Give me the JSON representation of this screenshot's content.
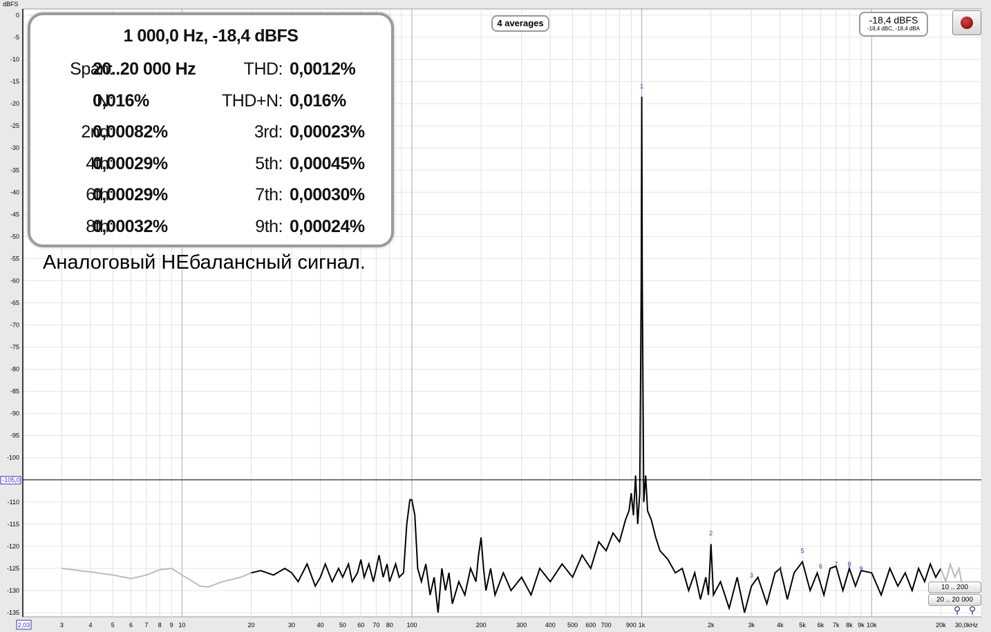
{
  "chart_data": {
    "type": "line",
    "ylabel": "dBFS",
    "xunit": "kHz",
    "x_scale": "log",
    "xlim": [
      2.03,
      30000
    ],
    "ylim": [
      -135,
      0
    ],
    "grid": true,
    "yticks": [
      0,
      -5,
      -10,
      -15,
      -20,
      -25,
      -30,
      -35,
      -40,
      -45,
      -50,
      -55,
      -60,
      -65,
      -70,
      -75,
      -80,
      -85,
      -90,
      -95,
      -100,
      -110,
      -115,
      -120,
      -125,
      -130,
      -135
    ],
    "xtick_labels": [
      [
        "3",
        3
      ],
      [
        "4",
        4
      ],
      [
        "5",
        5
      ],
      [
        "6",
        6
      ],
      [
        "7",
        7
      ],
      [
        "8",
        8
      ],
      [
        "9",
        9
      ],
      [
        "10",
        10
      ],
      [
        "20",
        20
      ],
      [
        "30",
        30
      ],
      [
        "40",
        40
      ],
      [
        "50",
        50
      ],
      [
        "60",
        60
      ],
      [
        "70",
        70
      ],
      [
        "80",
        80
      ],
      [
        "100",
        100
      ],
      [
        "200",
        200
      ],
      [
        "300",
        300
      ],
      [
        "400",
        400
      ],
      [
        "500",
        500
      ],
      [
        "600",
        600
      ],
      [
        "700",
        700
      ],
      [
        "900",
        900
      ],
      [
        "1k",
        1000
      ],
      [
        "2k",
        2000
      ],
      [
        "3k",
        3000
      ],
      [
        "4k",
        4000
      ],
      [
        "5k",
        5000
      ],
      [
        "6k",
        6000
      ],
      [
        "7k",
        7000
      ],
      [
        "8k",
        8000
      ],
      [
        "9k",
        9000
      ],
      [
        "10k",
        10000
      ],
      [
        "20k",
        20000
      ],
      [
        "30,0kHz",
        30000
      ]
    ],
    "cursor": {
      "x_label": "2,03",
      "y_label": "-105,0",
      "y": -105
    },
    "series": [
      {
        "color": "#bbbbbb",
        "points": [
          [
            3,
            -125
          ],
          [
            4,
            -125.8
          ],
          [
            5,
            -126.5
          ],
          [
            6,
            -127.3
          ],
          [
            7,
            -126.5
          ],
          [
            8,
            -125.3
          ],
          [
            9,
            -125
          ],
          [
            10,
            -126.5
          ],
          [
            12,
            -129
          ],
          [
            13,
            -129.2
          ],
          [
            15,
            -128
          ],
          [
            18,
            -127
          ],
          [
            20,
            -126
          ]
        ]
      },
      {
        "color": "#000000",
        "points": [
          [
            20,
            -126
          ],
          [
            22,
            -125.5
          ],
          [
            25,
            -126.5
          ],
          [
            28,
            -125
          ],
          [
            30,
            -126
          ],
          [
            32,
            -128
          ],
          [
            35,
            -124
          ],
          [
            38,
            -129
          ],
          [
            40,
            -127
          ],
          [
            42,
            -124
          ],
          [
            45,
            -128
          ],
          [
            48,
            -125
          ],
          [
            50,
            -127
          ],
          [
            53,
            -124
          ],
          [
            55,
            -128
          ],
          [
            58,
            -126
          ],
          [
            60,
            -123
          ],
          [
            62,
            -127
          ],
          [
            65,
            -124
          ],
          [
            68,
            -128
          ],
          [
            70,
            -125
          ],
          [
            72,
            -122
          ],
          [
            75,
            -127
          ],
          [
            78,
            -124
          ],
          [
            80,
            -128
          ],
          [
            85,
            -124
          ],
          [
            88,
            -127
          ],
          [
            92,
            -126
          ],
          [
            95,
            -115
          ],
          [
            98,
            -109.5
          ],
          [
            100,
            -109.5
          ],
          [
            103,
            -113
          ],
          [
            106,
            -125
          ],
          [
            110,
            -128
          ],
          [
            115,
            -124
          ],
          [
            120,
            -131
          ],
          [
            125,
            -127
          ],
          [
            130,
            -135
          ],
          [
            135,
            -125
          ],
          [
            140,
            -130
          ],
          [
            145,
            -126
          ],
          [
            150,
            -133
          ],
          [
            160,
            -128
          ],
          [
            170,
            -131
          ],
          [
            180,
            -125
          ],
          [
            190,
            -128
          ],
          [
            195,
            -122
          ],
          [
            200,
            -118
          ],
          [
            205,
            -125
          ],
          [
            210,
            -130
          ],
          [
            220,
            -125
          ],
          [
            230,
            -131
          ],
          [
            250,
            -126
          ],
          [
            270,
            -130
          ],
          [
            300,
            -127
          ],
          [
            330,
            -131
          ],
          [
            360,
            -125
          ],
          [
            400,
            -128
          ],
          [
            450,
            -124
          ],
          [
            500,
            -127
          ],
          [
            550,
            -122
          ],
          [
            600,
            -125
          ],
          [
            650,
            -119
          ],
          [
            700,
            -121
          ],
          [
            750,
            -117
          ],
          [
            800,
            -119
          ],
          [
            850,
            -114
          ],
          [
            880,
            -112
          ],
          [
            900,
            -108
          ],
          [
            920,
            -113
          ],
          [
            940,
            -104
          ],
          [
            960,
            -115
          ],
          [
            980,
            -108
          ],
          [
            995,
            -60
          ],
          [
            1000,
            -18.4
          ],
          [
            1005,
            -60
          ],
          [
            1020,
            -110
          ],
          [
            1040,
            -104
          ],
          [
            1060,
            -112
          ],
          [
            1100,
            -114
          ],
          [
            1150,
            -118
          ],
          [
            1200,
            -121
          ],
          [
            1300,
            -123
          ],
          [
            1400,
            -126
          ],
          [
            1500,
            -125
          ],
          [
            1600,
            -130
          ],
          [
            1700,
            -126
          ],
          [
            1800,
            -132
          ],
          [
            1900,
            -127
          ],
          [
            1950,
            -131
          ],
          [
            2000,
            -119.5
          ],
          [
            2050,
            -131
          ],
          [
            2200,
            -128
          ],
          [
            2400,
            -134
          ],
          [
            2600,
            -127
          ],
          [
            2800,
            -135
          ],
          [
            3000,
            -129
          ],
          [
            3200,
            -127
          ],
          [
            3500,
            -133
          ],
          [
            3800,
            -126
          ],
          [
            4000,
            -125
          ],
          [
            4300,
            -132
          ],
          [
            4600,
            -126
          ],
          [
            5000,
            -123.5
          ],
          [
            5400,
            -130
          ],
          [
            5800,
            -126
          ],
          [
            6200,
            -131
          ],
          [
            6600,
            -125
          ],
          [
            7000,
            -124.5
          ],
          [
            7500,
            -130
          ],
          [
            8000,
            -125
          ],
          [
            8500,
            -129
          ],
          [
            9000,
            -125.5
          ],
          [
            10000,
            -126
          ],
          [
            11000,
            -131
          ],
          [
            12000,
            -125
          ],
          [
            13000,
            -129
          ],
          [
            14000,
            -126
          ],
          [
            15000,
            -130
          ],
          [
            16000,
            -125
          ],
          [
            17000,
            -128
          ],
          [
            18000,
            -124
          ],
          [
            19000,
            -127
          ],
          [
            20000,
            -125
          ]
        ]
      },
      {
        "color": "#bbbbbb",
        "points": [
          [
            20000,
            -125
          ],
          [
            21000,
            -128
          ],
          [
            22000,
            -124
          ],
          [
            23000,
            -127
          ],
          [
            24000,
            -125
          ],
          [
            25000,
            -130
          ]
        ]
      }
    ],
    "harmonic_markers": [
      [
        "1",
        1000,
        -17
      ],
      [
        "2",
        2000,
        -118
      ],
      [
        "3",
        3000,
        -127.5
      ],
      [
        "4",
        4000,
        -126
      ],
      [
        "5",
        5000,
        -122
      ],
      [
        "6",
        6000,
        -125.5
      ],
      [
        "7",
        7000,
        -125
      ],
      [
        "8",
        8000,
        -125
      ],
      [
        "9",
        9000,
        -126
      ]
    ]
  },
  "panel": {
    "title": "1 000,0 Hz, -18,4 dBFS",
    "rows": [
      [
        {
          "label": "Span:",
          "value": "20..20 000 Hz"
        },
        {
          "label": "THD:",
          "value": "0,0012%"
        }
      ],
      [
        {
          "label": "N:",
          "value": "0,016%"
        },
        {
          "label": "THD+N:",
          "value": "0,016%"
        }
      ],
      [
        {
          "label": "2nd:",
          "value": "0,00082%"
        },
        {
          "label": "3rd:",
          "value": "0,00023%"
        }
      ],
      [
        {
          "label": "4th:",
          "value": "0,00029%"
        },
        {
          "label": "5th:",
          "value": "0,00045%"
        }
      ],
      [
        {
          "label": "6th:",
          "value": "0,00029%"
        },
        {
          "label": "7th:",
          "value": "0,00030%"
        }
      ],
      [
        {
          "label": "8th:",
          "value": "0,00032%"
        },
        {
          "label": "9th:",
          "value": "0,00024%"
        }
      ]
    ]
  },
  "caption": "Аналоговый НЕбалансный сигнал.",
  "averages": "4 averages",
  "level": {
    "main": "-18,4 dBFS",
    "sub": "-18,4 dBC, -18,4 dBA"
  },
  "buttons": {
    "range_low": "10 .. 200",
    "range_full": "20 .. 20 000"
  },
  "icons": [
    "record-icon",
    "zoom-in-icon",
    "zoom-out-icon"
  ]
}
